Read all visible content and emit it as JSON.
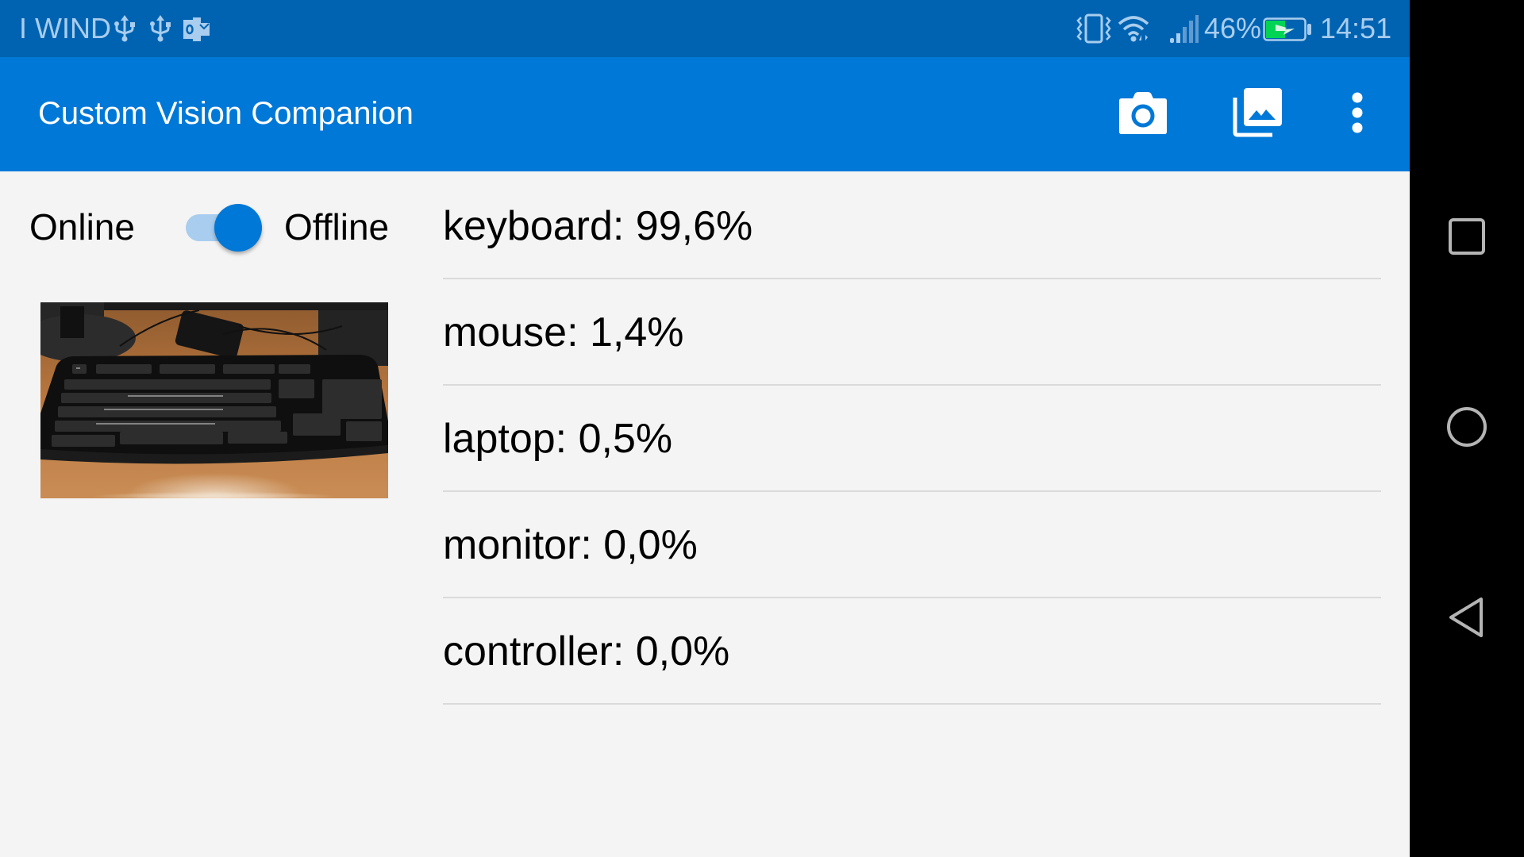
{
  "status_bar": {
    "carrier": "I WIND",
    "left_icons": [
      "usb-icon",
      "usb-icon",
      "outlook-icon"
    ],
    "right_icons": [
      "vibrate-icon",
      "wifi-icon",
      "signal-icon"
    ],
    "battery_percent": "46%",
    "battery_level": 0.46,
    "battery_charging": true,
    "time": "14:51"
  },
  "app_bar": {
    "title": "Custom Vision Companion",
    "actions": [
      {
        "name": "camera",
        "icon": "camera-icon"
      },
      {
        "name": "gallery",
        "icon": "photo-library-icon"
      },
      {
        "name": "more",
        "icon": "more-vert-icon"
      }
    ]
  },
  "mode_toggle": {
    "left_label": "Online",
    "right_label": "Offline",
    "checked": true
  },
  "image": {
    "description": "Black keyboard on wooden desk"
  },
  "predictions": [
    {
      "text": "keyboard: 99,6%",
      "tag": "keyboard",
      "probability": "99,6%"
    },
    {
      "text": "mouse: 1,4%",
      "tag": "mouse",
      "probability": "1,4%"
    },
    {
      "text": "laptop: 0,5%",
      "tag": "laptop",
      "probability": "0,5%"
    },
    {
      "text": "monitor: 0,0%",
      "tag": "monitor",
      "probability": "0,0%"
    },
    {
      "text": "controller: 0,0%",
      "tag": "controller",
      "probability": "0,0%"
    }
  ],
  "nav_bar": {
    "buttons": [
      "recents",
      "home",
      "back"
    ]
  },
  "colors": {
    "status_bar": "#0063B1",
    "app_bar": "#0078D7",
    "accent": "#0078D7",
    "switch_track": "#A9CDEE",
    "background": "#F4F4F4",
    "battery_fill": "#00D455"
  }
}
